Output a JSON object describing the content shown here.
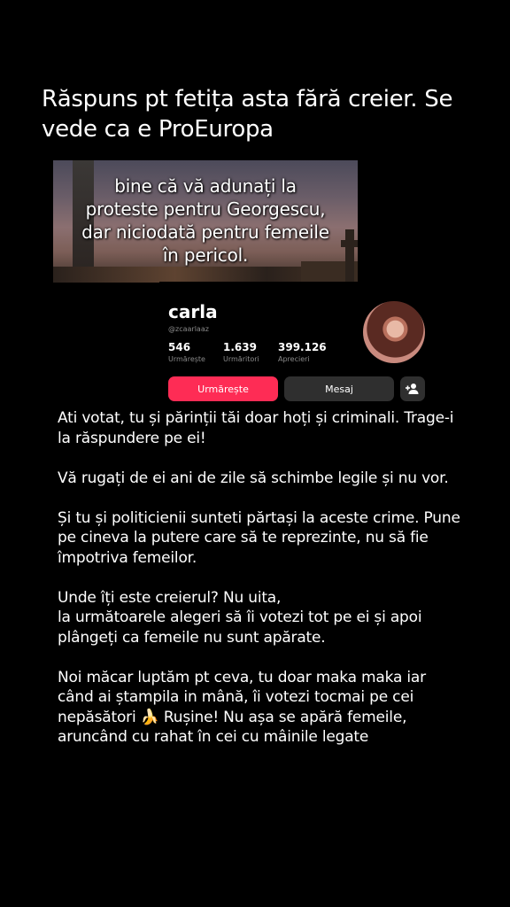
{
  "headline": {
    "line1": "Răspuns pt fetița asta fără creier. Se",
    "line2": "vede ca e ProEuropa"
  },
  "video_caption": {
    "line1": "bine că vă adunați la",
    "line2": "proteste pentru Georgescu,",
    "line3": "dar niciodată pentru femeile",
    "line4": "în pericol."
  },
  "profile": {
    "name": "carla",
    "handle": "@zcaarlaaz",
    "stats": [
      {
        "value": "546",
        "label": "Urmărește"
      },
      {
        "value": "1.639",
        "label": "Urmăritori"
      },
      {
        "value": "399.126",
        "label": "Aprecieri"
      }
    ],
    "follow_label": "Urmărește",
    "message_label": "Mesaj",
    "add_friend_icon": "add-friend-icon",
    "accent_color": "#fe2c55"
  },
  "body": {
    "p1_l1": "Ati votat, tu și părinții tăi doar hoți și criminali. Trage-i",
    "p1_l2": "la răspundere pe ei!",
    "p2_l1": "Vă rugați de ei ani de zile să schimbe legile și nu vor.",
    "p3_l1": "Și tu și politicienii sunteti părtași la aceste crime. Pune",
    "p3_l2": "pe cineva la putere care să te reprezinte, nu să fie",
    "p3_l3": "împotriva femeilor.",
    "p4_l1": "Unde îți este creierul? Nu uita,",
    "p4_l2": "la următoarele alegeri să îi votezi tot pe ei și apoi",
    "p4_l3": "plângeți ca femeile nu sunt apărate.",
    "p5_l1": "Noi măcar luptăm pt ceva, tu doar maka maka iar",
    "p5_l2": "când ai ștampila in mână, îi votezi tocmai pe cei",
    "p5_l3a": "nepăsători",
    "p5_emoji": "🍌",
    "p5_l3b": "Rușine! Nu așa se apără femeile,",
    "p5_l4": "aruncând cu rahat în cei cu mâinile legate"
  }
}
